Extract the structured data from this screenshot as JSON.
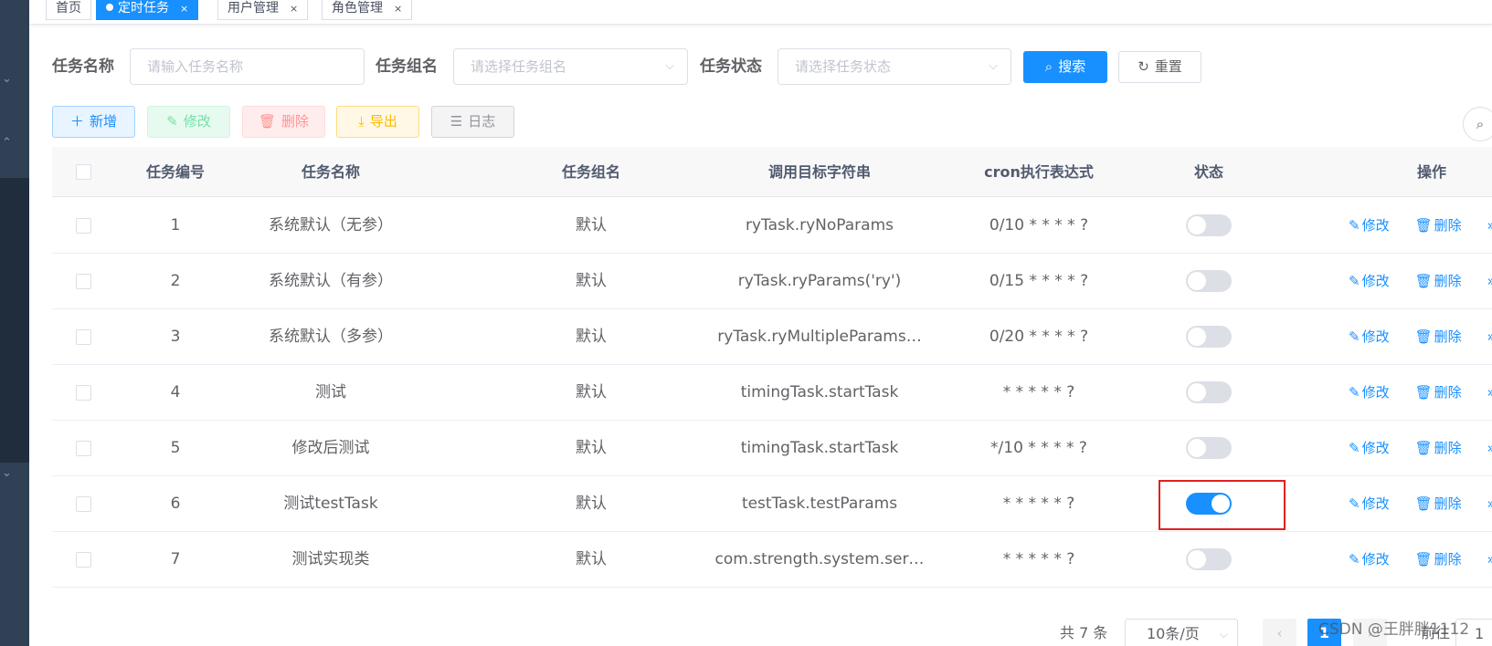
{
  "tags": [
    {
      "label": "首页",
      "active": false
    },
    {
      "label": "定时任务",
      "active": true
    },
    {
      "label": "用户管理",
      "active": false
    },
    {
      "label": "角色管理",
      "active": false
    }
  ],
  "search": {
    "task_name_label": "任务名称",
    "task_name_placeholder": "请输入任务名称",
    "task_group_label": "任务组名",
    "task_group_placeholder": "请选择任务组名",
    "task_status_label": "任务状态",
    "task_status_placeholder": "请选择任务状态",
    "search_button": "搜索",
    "reset_button": "重置"
  },
  "toolbar": {
    "add": "新增",
    "edit": "修改",
    "delete": "删除",
    "export": "导出",
    "log": "日志"
  },
  "table": {
    "columns": [
      "任务编号",
      "任务名称",
      "任务组名",
      "调用目标字符串",
      "cron执行表达式",
      "状态",
      "操作"
    ],
    "rows": [
      {
        "id": "1",
        "name": "系统默认（无参）",
        "group": "默认",
        "target": "ryTask.ryNoParams",
        "cron": "0/10 * * * * ?",
        "enabled": false
      },
      {
        "id": "2",
        "name": "系统默认（有参）",
        "group": "默认",
        "target": "ryTask.ryParams('ry')",
        "cron": "0/15 * * * * ?",
        "enabled": false
      },
      {
        "id": "3",
        "name": "系统默认（多参）",
        "group": "默认",
        "target": "ryTask.ryMultipleParams…",
        "cron": "0/20 * * * * ?",
        "enabled": false
      },
      {
        "id": "4",
        "name": "测试",
        "group": "默认",
        "target": "timingTask.startTask",
        "cron": "* * * * * ?",
        "enabled": false
      },
      {
        "id": "5",
        "name": "修改后测试",
        "group": "默认",
        "target": "timingTask.startTask",
        "cron": "*/10 * * * * ?",
        "enabled": false
      },
      {
        "id": "6",
        "name": "测试testTask",
        "group": "默认",
        "target": "testTask.testParams",
        "cron": "* * * * * ?",
        "enabled": true
      },
      {
        "id": "7",
        "name": "测试实现类",
        "group": "默认",
        "target": "com.strength.system.ser…",
        "cron": "* * * * * ?",
        "enabled": false
      }
    ],
    "ops": {
      "edit": "修改",
      "delete": "删除",
      "more": "更多"
    }
  },
  "pagination": {
    "total": "共 7 条",
    "page_size": "10条/页",
    "current_page": "1",
    "goto_label": "前往",
    "goto_value": "1"
  },
  "watermark": "CSDN @王胖胖1112",
  "colors": {
    "primary": "#1890ff",
    "highlight_border": "#e02020"
  }
}
